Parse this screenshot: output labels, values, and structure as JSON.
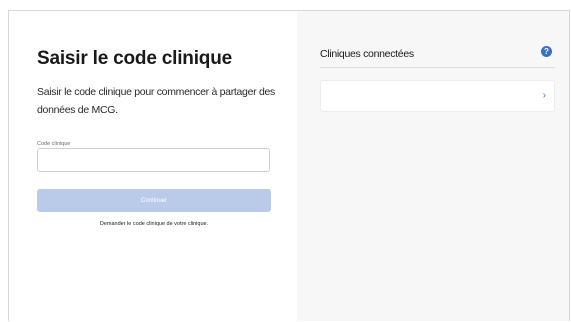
{
  "left": {
    "title": "Saisir le code clinique",
    "description": "Saisir le code clinique pour commencer à partager des données de MCG.",
    "field_label": "Code clinique",
    "field_value": "",
    "continue_label": "Continuer",
    "help_link": "Demander le code clinique de votre clinique."
  },
  "right": {
    "title": "Cliniques connectées",
    "info_icon": "?",
    "chevron_icon": "›"
  },
  "colors": {
    "accent": "#3b6fc7",
    "button_disabled": "#b9cbe8",
    "right_panel_bg": "#f7f7f7"
  },
  "icons": {
    "info": "info-icon",
    "chevron": "chevron-right-icon"
  }
}
